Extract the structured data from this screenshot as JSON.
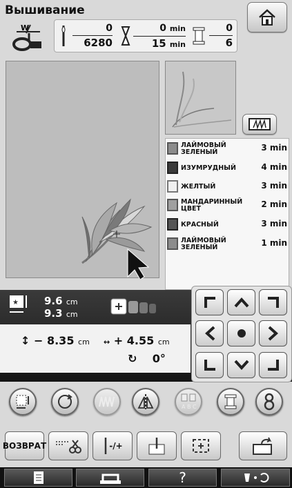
{
  "header": {
    "title": "Вышивание"
  },
  "status": {
    "stitch_current": "0",
    "stitch_total": "6280",
    "time_current": "0",
    "time_total": "15",
    "time_unit": "min",
    "color_current": "0",
    "color_total": "6"
  },
  "colors": [
    {
      "name": "ЛАЙМОВЫЙ ЗЕЛЕНЫЙ",
      "time": "3 min",
      "hex": "#8c8c8c"
    },
    {
      "name": "ИЗУМРУДНЫЙ",
      "time": "4 min",
      "hex": "#3a3a3a"
    },
    {
      "name": "ЖЕЛТЫЙ",
      "time": "3 min",
      "hex": "#f0f0f0"
    },
    {
      "name": "МАНДАРИННЫЙ ЦВЕТ",
      "time": "2 min",
      "hex": "#a0a0a0"
    },
    {
      "name": "КРАСНЫЙ",
      "time": "3 min",
      "hex": "#555555"
    },
    {
      "name": "ЛАЙМОВЫЙ ЗЕЛЕНЫЙ",
      "time": "1 min",
      "hex": "#8c8c8c"
    }
  ],
  "size": {
    "width": "9.6",
    "height": "9.3",
    "unit": "cm"
  },
  "position": {
    "y_sign": "−",
    "y": "8.35",
    "x_sign": "+",
    "x": "4.55",
    "unit": "cm"
  },
  "angle": "0°",
  "buttons": {
    "back_label": "ВОЗВРАТ",
    "tension_label": "-/+"
  },
  "icons": [
    "home-icon",
    "thread-icon",
    "needle-icon",
    "hourglass-icon",
    "spool-icon",
    "frame-icon",
    "arrow-icons",
    "rotate-icon",
    "mirror-icon"
  ]
}
